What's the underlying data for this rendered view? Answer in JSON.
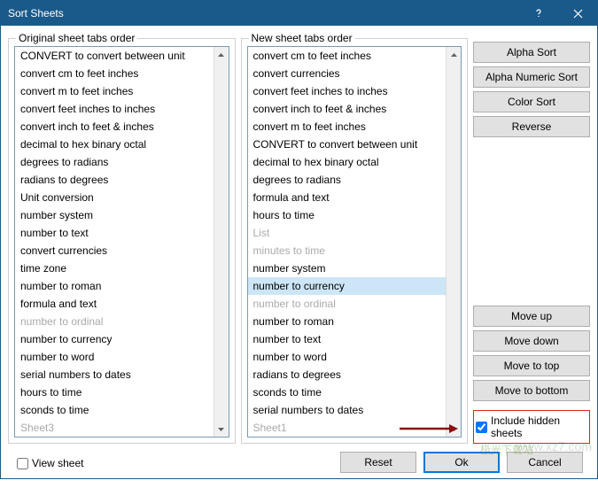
{
  "titlebar": {
    "title": "Sort Sheets"
  },
  "left_panel": {
    "label": "Original sheet tabs order",
    "items": [
      {
        "label": "CONVERT to convert between unit",
        "disabled": false
      },
      {
        "label": "convert cm to feet inches",
        "disabled": false
      },
      {
        "label": "convert m to feet inches",
        "disabled": false
      },
      {
        "label": "convert feet inches to inches",
        "disabled": false
      },
      {
        "label": "convert inch to feet & inches",
        "disabled": false
      },
      {
        "label": "decimal to hex binary octal",
        "disabled": false
      },
      {
        "label": "degrees to radians",
        "disabled": false
      },
      {
        "label": "radians to degrees",
        "disabled": false
      },
      {
        "label": "Unit conversion",
        "disabled": false
      },
      {
        "label": "number system",
        "disabled": false
      },
      {
        "label": "number to text",
        "disabled": false
      },
      {
        "label": "convert currencies",
        "disabled": false
      },
      {
        "label": "time zone",
        "disabled": false
      },
      {
        "label": "number to roman",
        "disabled": false
      },
      {
        "label": "formula and text",
        "disabled": false
      },
      {
        "label": "number to ordinal",
        "disabled": true
      },
      {
        "label": "number to currency",
        "disabled": false
      },
      {
        "label": "number to word",
        "disabled": false
      },
      {
        "label": "serial numbers to dates",
        "disabled": false
      },
      {
        "label": "hours to time",
        "disabled": false
      },
      {
        "label": "sconds to time",
        "disabled": false
      },
      {
        "label": "Sheet3",
        "disabled": true
      }
    ]
  },
  "right_panel": {
    "label": "New sheet tabs order",
    "items": [
      {
        "label": "convert cm to feet inches",
        "disabled": false
      },
      {
        "label": "convert currencies",
        "disabled": false
      },
      {
        "label": "convert feet inches to inches",
        "disabled": false
      },
      {
        "label": "convert inch to feet & inches",
        "disabled": false
      },
      {
        "label": "convert m to feet inches",
        "disabled": false
      },
      {
        "label": "CONVERT to convert between unit",
        "disabled": false
      },
      {
        "label": "decimal to hex binary octal",
        "disabled": false
      },
      {
        "label": "degrees to radians",
        "disabled": false
      },
      {
        "label": "formula and text",
        "disabled": false
      },
      {
        "label": "hours to time",
        "disabled": false
      },
      {
        "label": "List",
        "disabled": true
      },
      {
        "label": "minutes to time",
        "disabled": true
      },
      {
        "label": "number system",
        "disabled": false
      },
      {
        "label": "number to currency",
        "disabled": false,
        "selected": true
      },
      {
        "label": "number to ordinal",
        "disabled": true
      },
      {
        "label": "number to roman",
        "disabled": false
      },
      {
        "label": "number to text",
        "disabled": false
      },
      {
        "label": "number to word",
        "disabled": false
      },
      {
        "label": "radians to degrees",
        "disabled": false
      },
      {
        "label": "sconds to time",
        "disabled": false
      },
      {
        "label": "serial numbers to dates",
        "disabled": false
      },
      {
        "label": "Sheet1",
        "disabled": true
      }
    ]
  },
  "sort_buttons": {
    "alpha": "Alpha Sort",
    "alpha_num": "Alpha Numeric Sort",
    "color": "Color Sort",
    "reverse": "Reverse"
  },
  "move_buttons": {
    "up": "Move up",
    "down": "Move down",
    "top": "Move to top",
    "bottom": "Move to bottom"
  },
  "include_hidden": {
    "label": "Include hidden sheets",
    "checked": true
  },
  "view_sheet": {
    "label": "View sheet",
    "checked": false
  },
  "footer": {
    "reset": "Reset",
    "ok": "Ok",
    "cancel": "Cancel"
  },
  "watermark": {
    "logo": "极光下载站",
    "url": "www.xz7.com"
  }
}
